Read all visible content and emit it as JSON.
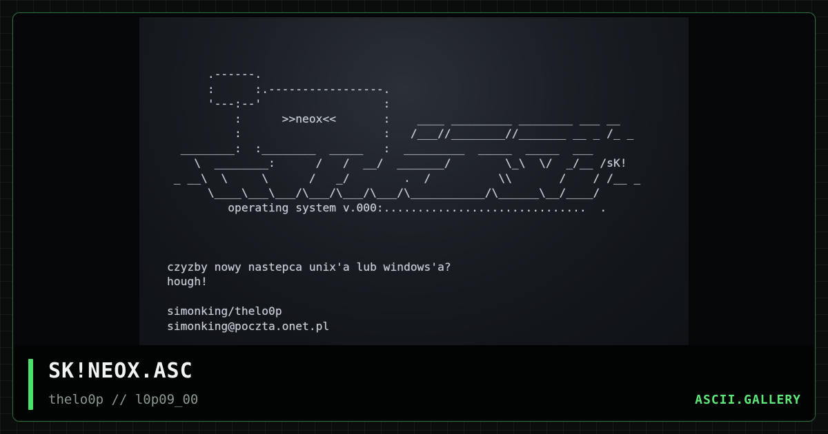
{
  "art": {
    "text": "      .------.\n      :      :.-----------------.\n      '---:--'                  :\n          :      >>neox<<       :    ____ _________ ________ ___ __\n          :                     :   /___//________//_______ __ _ /_ _\n  ________:  :________  _____   :  _________  _____  _____  ___\n    \\  ________:      /   /  __/  _______/        \\_\\  \\/  _/__ /sK!\n _ __\\  \\     \\      /   _/        .  /          \\\\       /    / /__ _\n      \\____\\___\\___/\\___/\\___/\\___/\\___________/\\______\\__/____/\n         operating system v.000:..............................  .\n\n\n\nczyzby nowy nastepca unix'a lub windows'a?\nhough!\n\nsimonking/thelo0p\nsimonking@poczta.onet.pl"
  },
  "footer": {
    "title": "SK!NEOX.ASC",
    "subtitle": "thelo0p // l0p09_00",
    "brand": "ASCII.GALLERY"
  },
  "colors": {
    "accent": "#4be06a",
    "brand": "#5ee87a",
    "border": "#2f6b3c",
    "art_text": "#c9ced6"
  }
}
